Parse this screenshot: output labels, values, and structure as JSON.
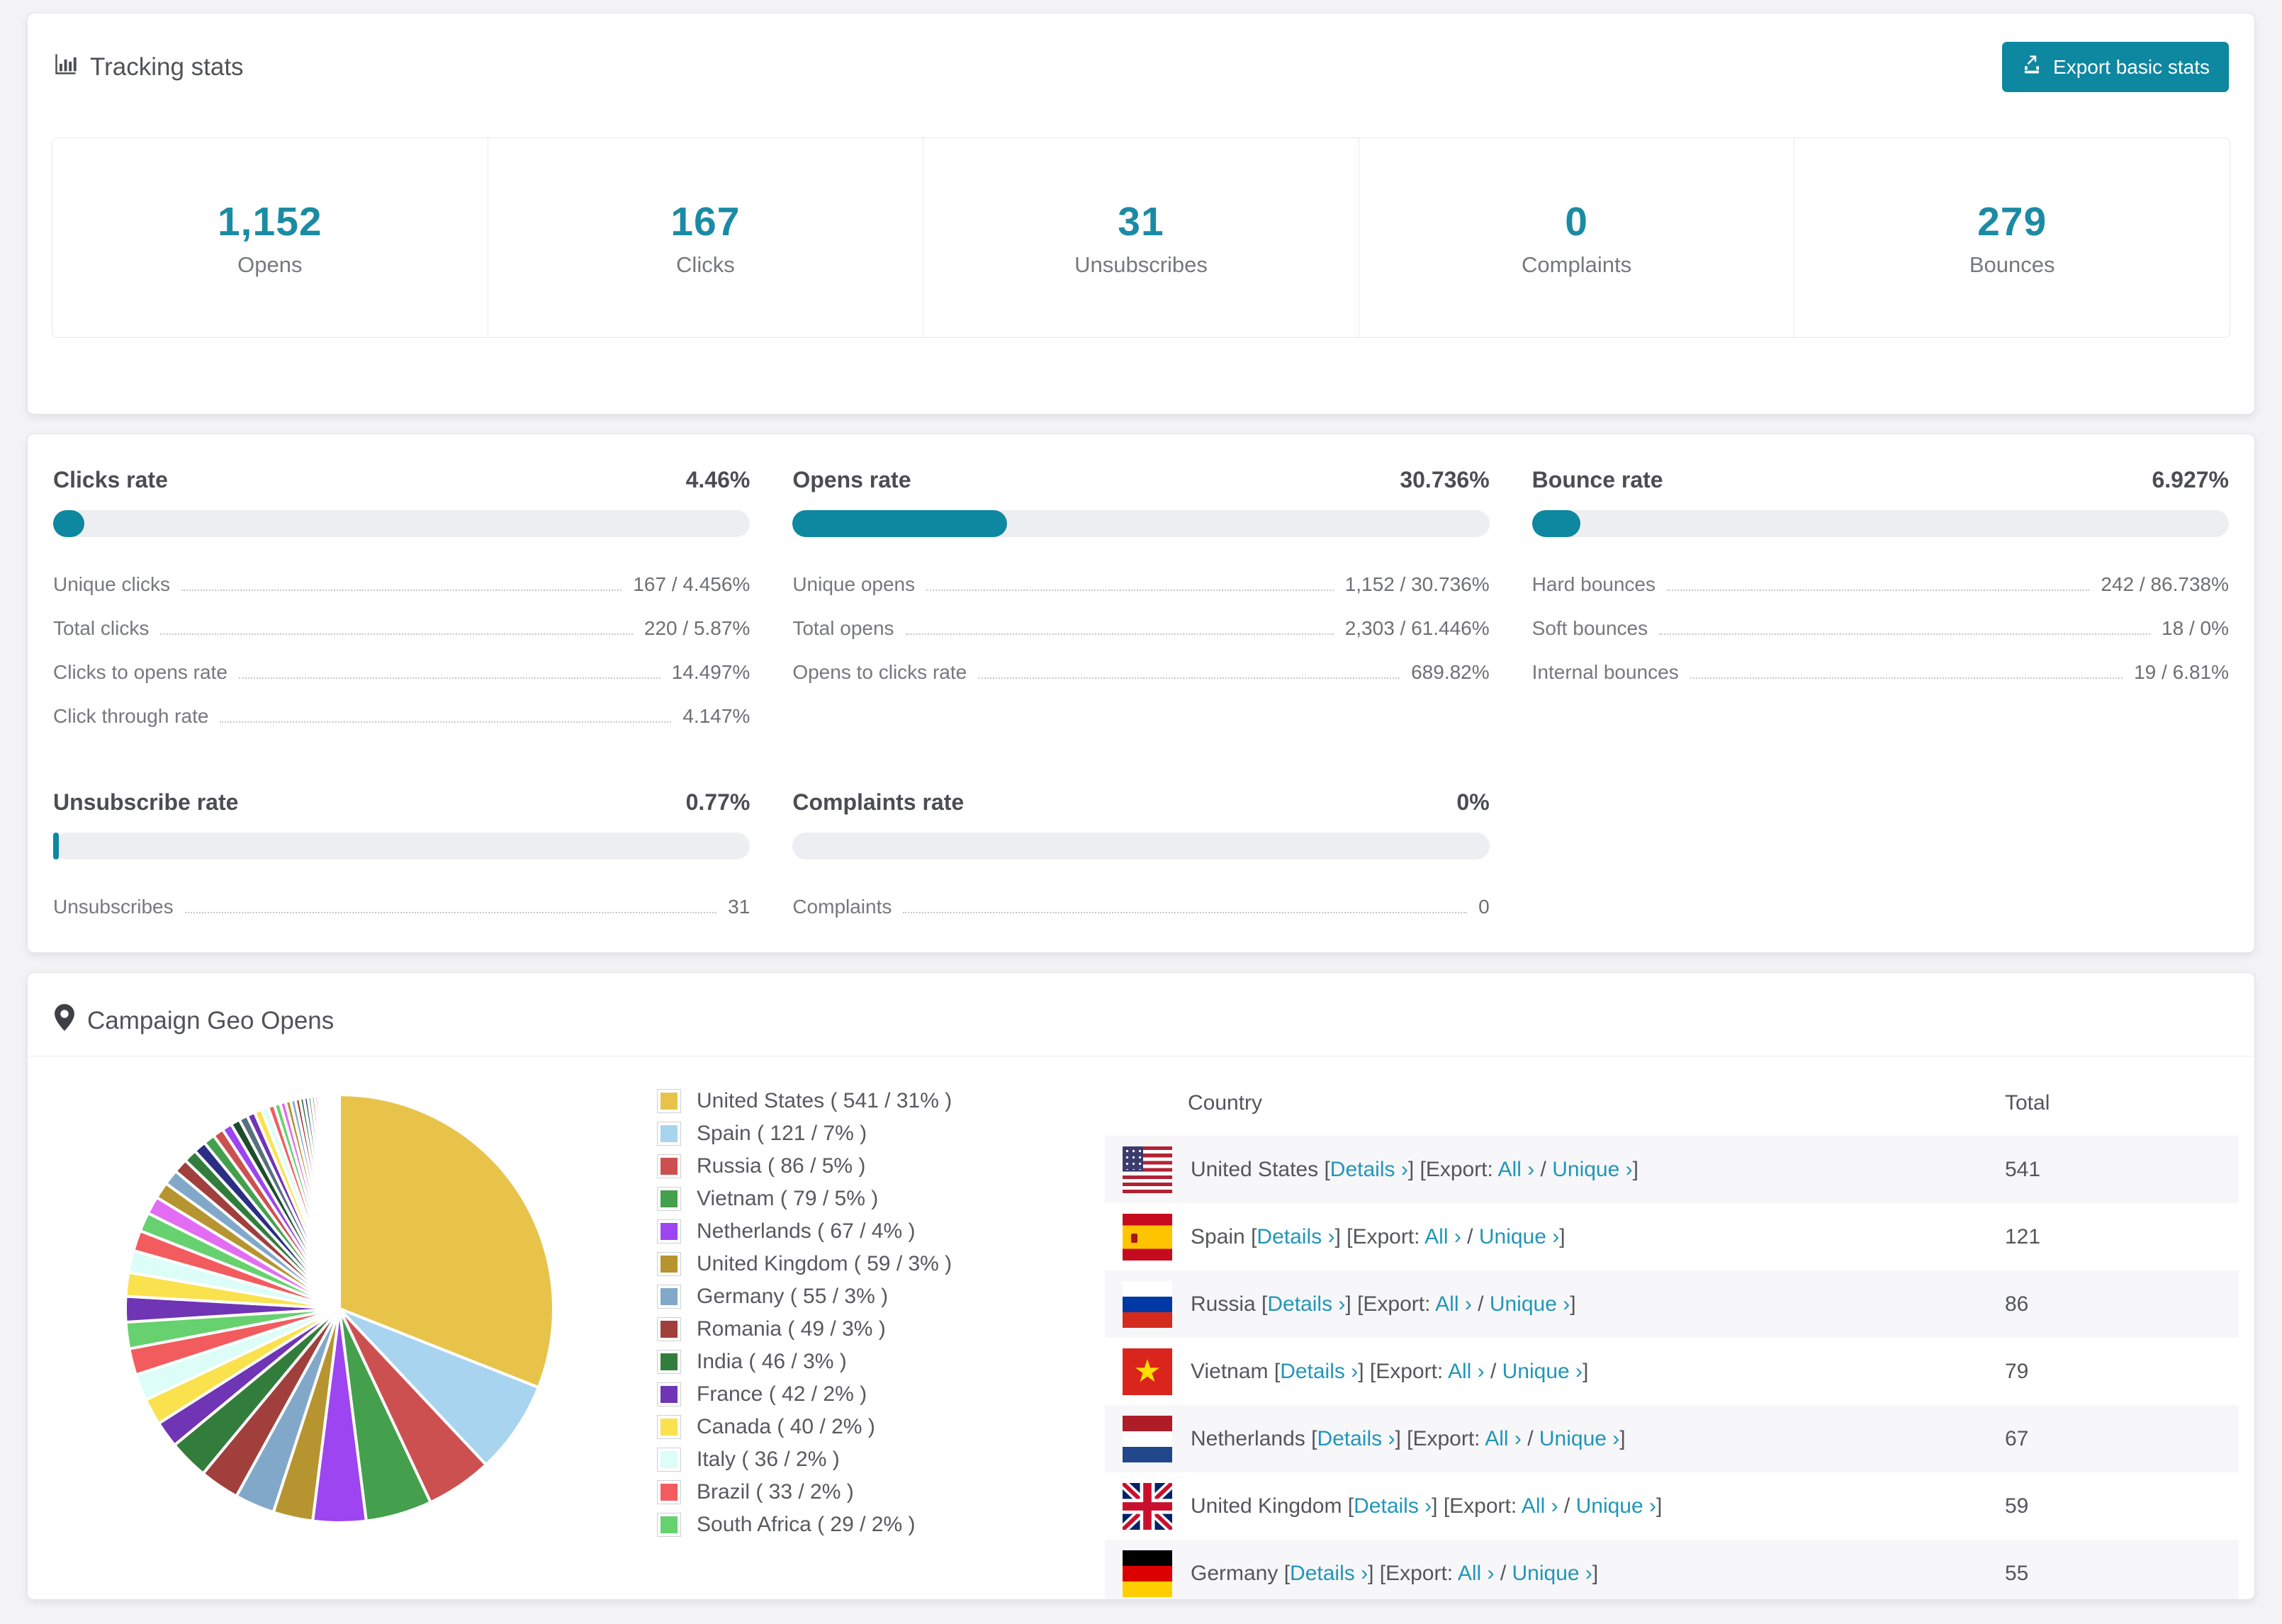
{
  "colors": {
    "accent": "#0e87a0",
    "link": "#2196b8",
    "bar_track": "#edeef2",
    "stat_number": "#1b8ba4"
  },
  "tracking": {
    "title": "Tracking stats",
    "export_button": "Export basic stats",
    "stats": [
      {
        "value": "1,152",
        "label": "Opens"
      },
      {
        "value": "167",
        "label": "Clicks"
      },
      {
        "value": "31",
        "label": "Unsubscribes"
      },
      {
        "value": "0",
        "label": "Complaints"
      },
      {
        "value": "279",
        "label": "Bounces"
      }
    ]
  },
  "rates": [
    {
      "title": "Clicks rate",
      "value": "4.46%",
      "pct": 4.46,
      "rows": [
        [
          "Unique clicks",
          "167 / 4.456%"
        ],
        [
          "Total clicks",
          "220 / 5.87%"
        ],
        [
          "Clicks to opens rate",
          "14.497%"
        ],
        [
          "Click through rate",
          "4.147%"
        ]
      ]
    },
    {
      "title": "Opens rate",
      "value": "30.736%",
      "pct": 30.736,
      "rows": [
        [
          "Unique opens",
          "1,152 / 30.736%"
        ],
        [
          "Total opens",
          "2,303 / 61.446%"
        ],
        [
          "Opens to clicks rate",
          "689.82%"
        ]
      ]
    },
    {
      "title": "Bounce rate",
      "value": "6.927%",
      "pct": 6.927,
      "rows": [
        [
          "Hard bounces",
          "242 / 86.738%"
        ],
        [
          "Soft bounces",
          "18 / 0%"
        ],
        [
          "Internal bounces",
          "19 / 6.81%"
        ]
      ]
    },
    {
      "title": "Unsubscribe rate",
      "value": "0.77%",
      "pct": 0.77,
      "rows": [
        [
          "Unsubscribes",
          "31"
        ]
      ]
    },
    {
      "title": "Complaints rate",
      "value": "0%",
      "pct": 0,
      "rows": [
        [
          "Complaints",
          "0"
        ]
      ]
    }
  ],
  "geo": {
    "title": "Campaign Geo Opens",
    "table_headers": {
      "country": "Country",
      "total": "Total"
    },
    "links": {
      "details": "Details ›",
      "export_prefix": "[Export:",
      "all": "All ›",
      "unique": "Unique ›",
      "bracket_open": "[",
      "bracket_close": "]",
      "slash": "/"
    },
    "visible_rows": 7
  },
  "chart_data": {
    "type": "pie",
    "title": "Campaign Geo Opens",
    "legend_position": "right",
    "labels": [
      "United States",
      "Spain",
      "Russia",
      "Vietnam",
      "Netherlands",
      "United Kingdom",
      "Germany",
      "Romania",
      "India",
      "France",
      "Canada",
      "Italy",
      "Brazil",
      "South Africa"
    ],
    "values": [
      541,
      121,
      86,
      79,
      67,
      59,
      55,
      49,
      46,
      42,
      40,
      36,
      33,
      29
    ],
    "pcts": [
      31,
      7,
      5,
      5,
      4,
      3,
      3,
      3,
      3,
      2,
      2,
      2,
      2,
      2
    ],
    "colors": [
      "#e8c34a",
      "#a8d4f0",
      "#cd5051",
      "#44a04c",
      "#9c45f0",
      "#b6942f",
      "#82a8c9",
      "#a03f3c",
      "#337d3c",
      "#6f35b5",
      "#fae14e",
      "#dcfdf8",
      "#f25c5f",
      "#66d16e"
    ],
    "others_total_pct": 26,
    "others_slice_count": 40,
    "others_palette": [
      "#6f35b5",
      "#fae14e",
      "#dcfdf8",
      "#f25c5f",
      "#66d16e",
      "#e36df2",
      "#b6942f",
      "#82a8c9",
      "#a03f3c",
      "#337d3c",
      "#2b2e83",
      "#44a04c",
      "#cd5051",
      "#9c45f0",
      "#1d4d2b",
      "#56707e"
    ],
    "flags": [
      "us",
      "es",
      "ru",
      "vn",
      "nl",
      "gb",
      "de",
      "ro",
      "in",
      "fr",
      "ca",
      "it",
      "br",
      "za"
    ]
  }
}
